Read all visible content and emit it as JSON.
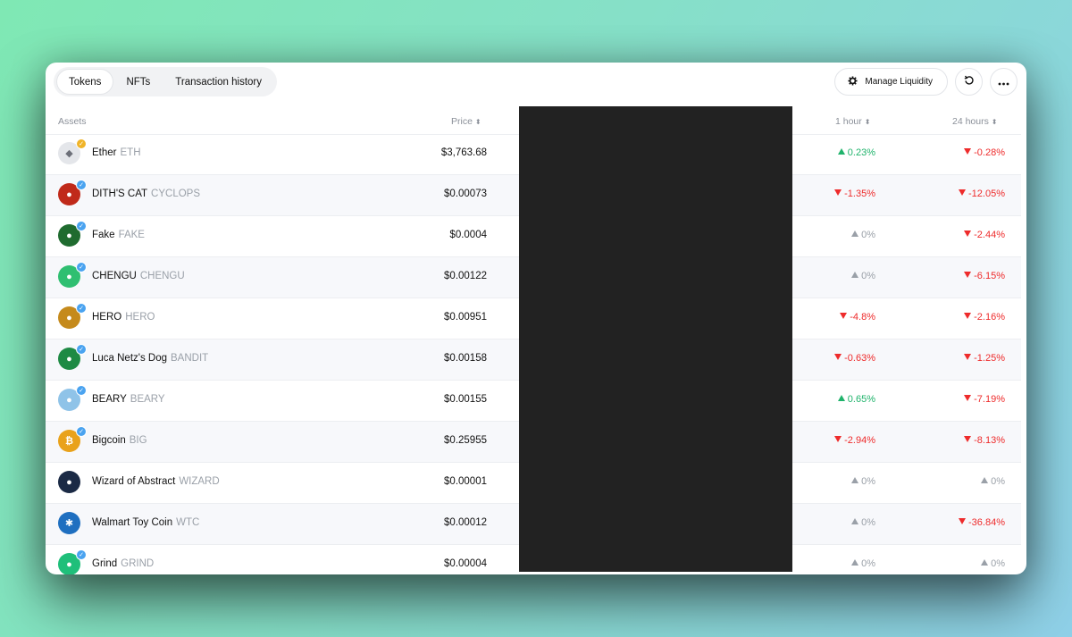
{
  "tabs": [
    "Tokens",
    "NFTs",
    "Transaction history"
  ],
  "toolbar": {
    "manage_label": "Manage Liquidity"
  },
  "headers": {
    "assets": "Assets",
    "price": "Price",
    "h1": "1 hour",
    "h24": "24 hours"
  },
  "tokens": [
    {
      "name": "Ether",
      "symbol": "ETH",
      "price": "$3,763.68",
      "h1": "0.23%",
      "h1_dir": "up",
      "h24": "-0.28%",
      "h24_dir": "down",
      "color": "#e4e6ea",
      "glyph": "◆",
      "badge": "#f0b429"
    },
    {
      "name": "DITH'S CAT",
      "symbol": "CYCLOPS",
      "price": "$0.00073",
      "h1": "-1.35%",
      "h1_dir": "down",
      "h24": "-12.05%",
      "h24_dir": "down",
      "color": "#c02a1a",
      "glyph": "●",
      "badge": "#4aa3f0"
    },
    {
      "name": "Fake",
      "symbol": "FAKE",
      "price": "$0.0004",
      "h1": "0%",
      "h1_dir": "flat",
      "h24": "-2.44%",
      "h24_dir": "down",
      "color": "#1f6b2f",
      "glyph": "●",
      "badge": "#4aa3f0"
    },
    {
      "name": "CHENGU",
      "symbol": "CHENGU",
      "price": "$0.00122",
      "h1": "0%",
      "h1_dir": "flat",
      "h24": "-6.15%",
      "h24_dir": "down",
      "color": "#2fbf71",
      "glyph": "●",
      "badge": "#4aa3f0"
    },
    {
      "name": "HERO",
      "symbol": "HERO",
      "price": "$0.00951",
      "h1": "-4.8%",
      "h1_dir": "down",
      "h24": "-2.16%",
      "h24_dir": "down",
      "color": "#c58a1c",
      "glyph": "●",
      "badge": "#4aa3f0"
    },
    {
      "name": "Luca Netz's Dog",
      "symbol": "BANDIT",
      "price": "$0.00158",
      "h1": "-0.63%",
      "h1_dir": "down",
      "h24": "-1.25%",
      "h24_dir": "down",
      "color": "#1e8a44",
      "glyph": "●",
      "badge": "#4aa3f0"
    },
    {
      "name": "BEARY",
      "symbol": "BEARY",
      "price": "$0.00155",
      "h1": "0.65%",
      "h1_dir": "up",
      "h24": "-7.19%",
      "h24_dir": "down",
      "color": "#8fc3e8",
      "glyph": "●",
      "badge": "#4aa3f0"
    },
    {
      "name": "Bigcoin",
      "symbol": "BIG",
      "price": "$0.25955",
      "h1": "-2.94%",
      "h1_dir": "down",
      "h24": "-8.13%",
      "h24_dir": "down",
      "color": "#e9a21b",
      "glyph": "₿",
      "badge": "#4aa3f0"
    },
    {
      "name": "Wizard of Abstract",
      "symbol": "WIZARD",
      "price": "$0.00001",
      "h1": "0%",
      "h1_dir": "flat",
      "h24": "0%",
      "h24_dir": "flat",
      "color": "#1b2a45",
      "glyph": "●",
      "badge": ""
    },
    {
      "name": "Walmart Toy Coin",
      "symbol": "WTC",
      "price": "$0.00012",
      "h1": "0%",
      "h1_dir": "flat",
      "h24": "-36.84%",
      "h24_dir": "down",
      "color": "#1f6fc0",
      "glyph": "✱",
      "badge": ""
    },
    {
      "name": "Grind",
      "symbol": "GRIND",
      "price": "$0.00004",
      "h1": "0%",
      "h1_dir": "flat",
      "h24": "0%",
      "h24_dir": "flat",
      "color": "#1fbf7a",
      "glyph": "●",
      "badge": "#4aa3f0"
    }
  ]
}
